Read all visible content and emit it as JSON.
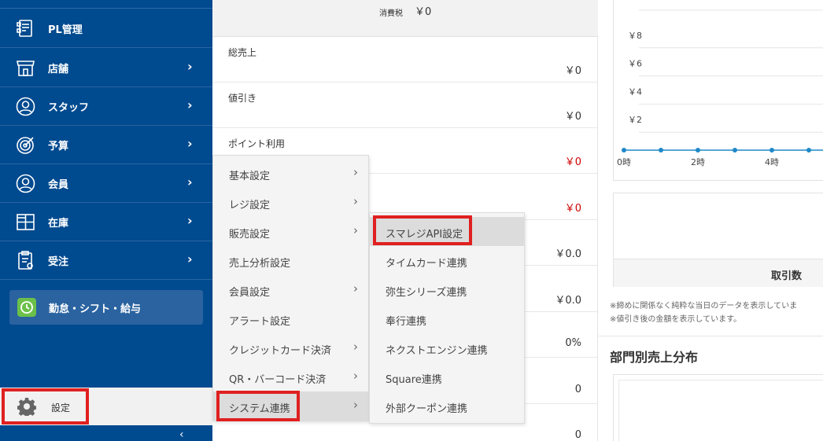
{
  "sidebar": {
    "items": [
      {
        "label": "PL管理",
        "icon": "pl-report-icon",
        "has_submenu": false
      },
      {
        "label": "店舗",
        "icon": "store-icon",
        "has_submenu": true
      },
      {
        "label": "スタッフ",
        "icon": "staff-icon",
        "has_submenu": true
      },
      {
        "label": "予算",
        "icon": "target-icon",
        "has_submenu": true
      },
      {
        "label": "会員",
        "icon": "member-icon",
        "has_submenu": true
      },
      {
        "label": "在庫",
        "icon": "inventory-icon",
        "has_submenu": true
      },
      {
        "label": "受注",
        "icon": "order-icon",
        "has_submenu": true
      }
    ],
    "chevron": "›",
    "attendance_label": "勤怠・シフト・給与",
    "settings_label": "設定",
    "collapse_glyph": "‹"
  },
  "summary": {
    "tax_label": "消費税",
    "tax_value": "￥0",
    "rows": [
      {
        "label": "総売上",
        "value": "￥0",
        "color": "normal"
      },
      {
        "label": "値引き",
        "value": "￥0",
        "color": "normal"
      },
      {
        "label": "ポイント利用",
        "value": "￥0",
        "color": "red"
      },
      {
        "label": "",
        "value": "￥0",
        "color": "red"
      },
      {
        "label": "",
        "value": "￥0.0",
        "color": "normal"
      },
      {
        "label": "",
        "value": "￥0.0",
        "color": "normal"
      },
      {
        "label": "",
        "value": "0%",
        "color": "normal"
      },
      {
        "label": "",
        "value": "0",
        "color": "normal"
      },
      {
        "label": "",
        "value": "0",
        "color": "normal"
      }
    ]
  },
  "settings_menu": {
    "items": [
      {
        "label": "基本設定",
        "has_submenu": true
      },
      {
        "label": "レジ設定",
        "has_submenu": true
      },
      {
        "label": "販売設定",
        "has_submenu": true
      },
      {
        "label": "売上分析設定",
        "has_submenu": false
      },
      {
        "label": "会員設定",
        "has_submenu": true
      },
      {
        "label": "アラート設定",
        "has_submenu": false
      },
      {
        "label": "クレジットカード決済",
        "has_submenu": true
      },
      {
        "label": "QR・バーコード決済",
        "has_submenu": true
      },
      {
        "label": "システム連携",
        "has_submenu": true,
        "active": true
      }
    ]
  },
  "system_menu": {
    "items": [
      {
        "label": "スマレジAPI設定",
        "active": true
      },
      {
        "label": "タイムカード連携"
      },
      {
        "label": "弥生シリーズ連携"
      },
      {
        "label": "奉行連携"
      },
      {
        "label": "ネクストエンジン連携"
      },
      {
        "label": "Square連携"
      },
      {
        "label": "外部クーポン連携"
      }
    ]
  },
  "chart_data": {
    "type": "line",
    "title": "",
    "xlabel": "",
    "ylabel": "",
    "y_tick_labels": [
      "￥8",
      "￥6",
      "￥4",
      "￥2"
    ],
    "x_tick_labels": [
      "0時",
      "2時",
      "4時"
    ],
    "x": [
      0,
      1,
      2,
      3,
      4,
      5,
      6
    ],
    "series": [
      {
        "values": [
          0,
          0,
          0,
          0,
          0,
          0,
          0
        ]
      }
    ],
    "ylim": [
      0,
      10
    ],
    "grid": true
  },
  "right": {
    "deal_label": "取引数",
    "notes": [
      "※締めに関係なく純粋な当日のデータを表示していま",
      "※値引き後の金額を表示しています。"
    ],
    "dept_title": "部門別売上分布"
  },
  "colors": {
    "sidebar_bg": "#004a8f",
    "highlight": "#e02020",
    "negative_value": "#d00000",
    "attendance_icon": "#6cc04a",
    "line_series": "#1e88c8"
  }
}
